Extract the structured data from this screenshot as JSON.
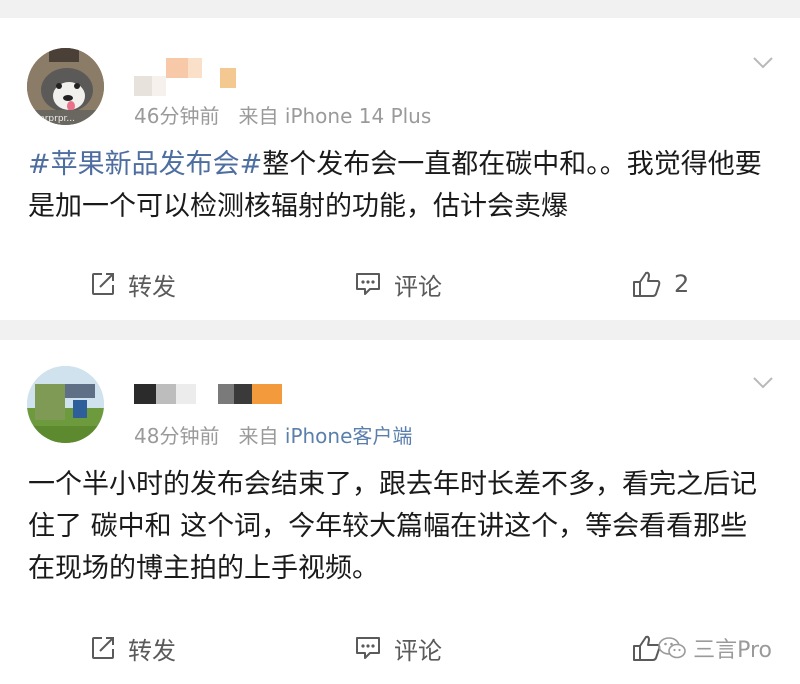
{
  "posts": [
    {
      "id": "post-1",
      "time": "46分钟前",
      "source_prefix": "来自",
      "source": "iPhone 14 Plus",
      "topic": "#苹果新品发布会#",
      "text": "整个发布会一直都在碳中和。。我觉得他要是加一个可以检测核辐射的功能，估计会卖爆",
      "avatar_caption": "prprpr...",
      "actions": {
        "repost": "转发",
        "comment": "评论",
        "like_count": "2"
      }
    },
    {
      "id": "post-2",
      "time": "48分钟前",
      "source_prefix": "来自",
      "source": "iPhone客户端",
      "text": "一个半小时的发布会结束了，跟去年时长差不多，看完之后记住了 碳中和 这个词，今年较大篇幅在讲这个，等会看看那些在现场的博主拍的上手视频。",
      "actions": {
        "repost": "转发",
        "comment": "评论"
      }
    }
  ],
  "watermark": {
    "text": "三言Pro"
  },
  "colors": {
    "topic": "#4e6ea0",
    "source_link": "#5b7fad",
    "meta": "#9a9a9a",
    "text": "#1a1a1a",
    "background": "#f1f1f1"
  },
  "icons": [
    "repost-icon",
    "comment-icon",
    "like-icon",
    "chevron-down-icon",
    "wechat-icon"
  ]
}
